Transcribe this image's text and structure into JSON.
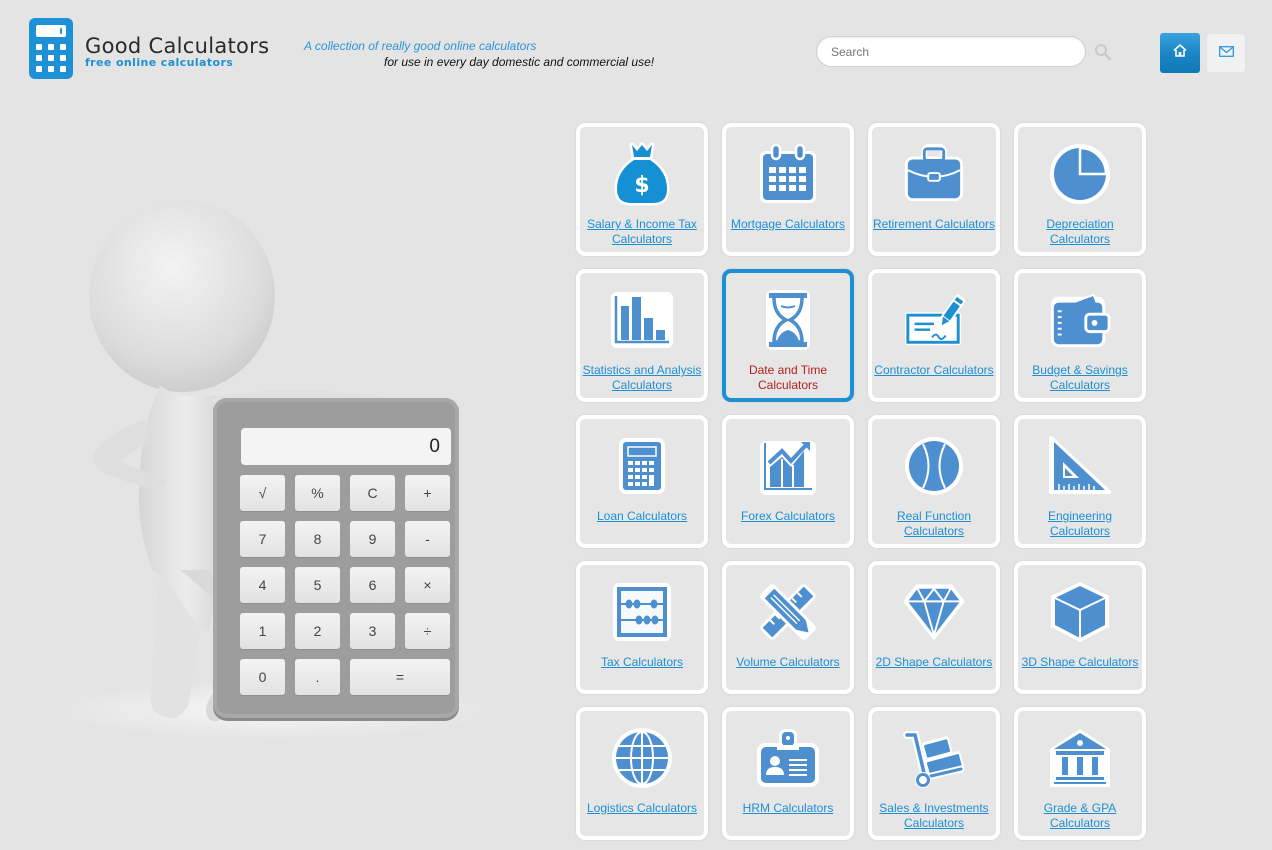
{
  "header": {
    "logo_title": "Good Calculators",
    "logo_subtitle": "free online calculators",
    "tagline_line1": "A collection of really good online calculators",
    "tagline_line2": "for use in every day domestic and commercial use!",
    "search_placeholder": "Search",
    "search_value": "",
    "icons": {
      "search": "search-icon",
      "home": "home-icon",
      "mail": "mail-icon"
    },
    "colors": {
      "brand": "#1e91d6",
      "link": "#1d8fd3",
      "active_label": "#b42020"
    }
  },
  "calculator": {
    "display": "0",
    "keys": [
      "√",
      "%",
      "C",
      "+",
      "7",
      "8",
      "9",
      "-",
      "4",
      "5",
      "6",
      "×",
      "1",
      "2",
      "3",
      "÷",
      "0",
      ".",
      "="
    ]
  },
  "categories": [
    {
      "label": "Salary & Income Tax Calculators",
      "icon": "money-bag-icon"
    },
    {
      "label": "Mortgage Calculators",
      "icon": "calendar-icon"
    },
    {
      "label": "Retirement Calculators",
      "icon": "briefcase-icon"
    },
    {
      "label": "Depreciation Calculators",
      "icon": "pie-chart-icon"
    },
    {
      "label": "Statistics and Analysis Calculators",
      "icon": "bar-chart-icon"
    },
    {
      "label": "Date and Time Calculators",
      "icon": "hourglass-icon",
      "active": true
    },
    {
      "label": "Contractor Calculators",
      "icon": "cheque-pen-icon"
    },
    {
      "label": "Budget & Savings Calculators",
      "icon": "wallet-icon"
    },
    {
      "label": "Loan Calculators",
      "icon": "calculator-icon"
    },
    {
      "label": "Forex Calculators",
      "icon": "trend-chart-icon"
    },
    {
      "label": "Real Function Calculators",
      "icon": "ball-icon"
    },
    {
      "label": "Engineering Calculators",
      "icon": "set-square-icon"
    },
    {
      "label": "Tax Calculators",
      "icon": "abacus-icon"
    },
    {
      "label": "Volume Calculators",
      "icon": "pencil-ruler-icon"
    },
    {
      "label": "2D Shape Calculators",
      "icon": "diamond-icon"
    },
    {
      "label": "3D Shape Calculators",
      "icon": "cube-icon"
    },
    {
      "label": "Logistics Calculators",
      "icon": "globe-icon"
    },
    {
      "label": "HRM Calculators",
      "icon": "id-badge-icon"
    },
    {
      "label": "Sales & Investments Calculators",
      "icon": "hand-truck-icon"
    },
    {
      "label": "Grade & GPA Calculators",
      "icon": "institution-icon"
    }
  ]
}
